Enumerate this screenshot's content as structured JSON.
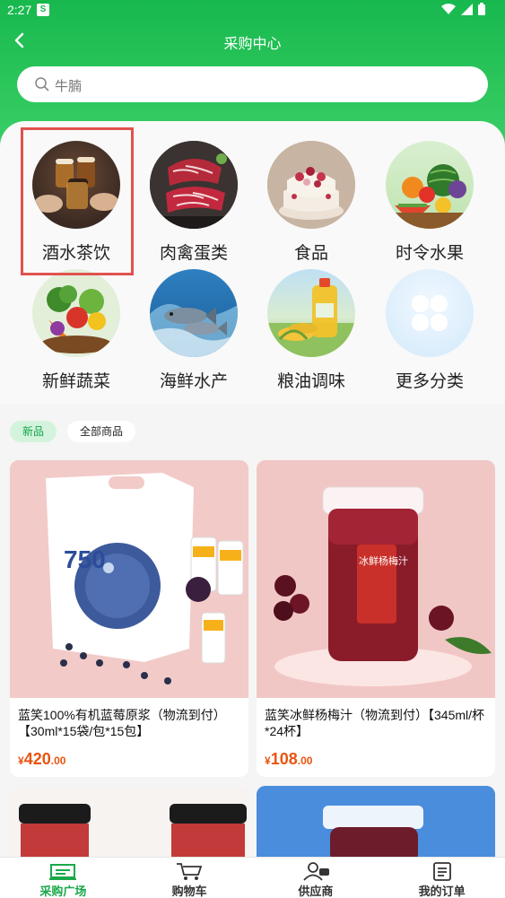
{
  "status": {
    "time": "2:27",
    "notif": "S"
  },
  "header": {
    "title": "采购中心"
  },
  "search": {
    "placeholder": "牛腩"
  },
  "categories": [
    {
      "label": "酒水茶饮",
      "icon": "beer-glasses-photo"
    },
    {
      "label": "肉禽蛋类",
      "icon": "raw-meat-photo"
    },
    {
      "label": "食品",
      "icon": "cake-photo"
    },
    {
      "label": "时令水果",
      "icon": "fruit-photo"
    },
    {
      "label": "新鲜蔬菜",
      "icon": "vegetables-photo"
    },
    {
      "label": "海鲜水产",
      "icon": "seafood-photo"
    },
    {
      "label": "粮油调味",
      "icon": "cooking-oil-photo"
    },
    {
      "label": "更多分类",
      "icon": "more-grid-icon"
    }
  ],
  "tabs": [
    {
      "label": "新品"
    },
    {
      "label": "全部商品"
    }
  ],
  "products": [
    {
      "name": "蓝笑100%有机蓝莓原浆（物流到付）【30ml*15袋/包*15包】",
      "currency": "¥",
      "price_int": "420",
      "price_dec": ".00",
      "img_text": "750"
    },
    {
      "name": "蓝笑冰鲜杨梅汁（物流到付）【345ml/杯*24杯】",
      "currency": "¥",
      "price_int": "108",
      "price_dec": ".00",
      "img_text": "冰鲜杨梅汁"
    }
  ],
  "tabbar": [
    {
      "label": "采购广场",
      "icon": "store-icon"
    },
    {
      "label": "购物车",
      "icon": "cart-icon"
    },
    {
      "label": "供应商",
      "icon": "supplier-icon"
    },
    {
      "label": "我的订单",
      "icon": "order-icon"
    }
  ],
  "colors": {
    "primary": "#1ba84b",
    "price": "#e8540f",
    "highlight": "#e0524f"
  }
}
